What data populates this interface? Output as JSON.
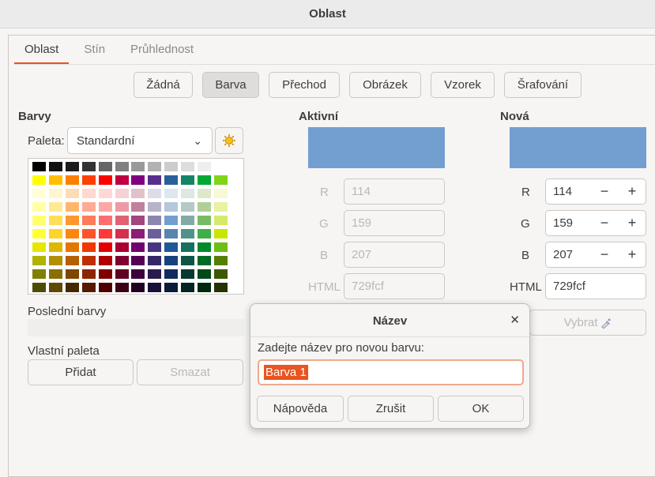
{
  "window": {
    "title": "Oblast"
  },
  "tabs": [
    {
      "label": "Oblast",
      "active": true
    },
    {
      "label": "Stín",
      "active": false
    },
    {
      "label": "Průhlednost",
      "active": false
    }
  ],
  "fill_types": [
    "Žádná",
    "Barva",
    "Přechod",
    "Obrázek",
    "Vzorek",
    "Šrafování"
  ],
  "fill_type_selected": "Barva",
  "colors_panel": {
    "heading": "Barvy",
    "palette_label": "Paleta:",
    "palette_value": "Standardní",
    "recent_label": "Poslední barvy",
    "custom_label": "Vlastní paleta",
    "add_label": "Přidat",
    "delete_label": "Smazat"
  },
  "palette": [
    [
      "#000000",
      "#111111",
      "#1c1c1c",
      "#333333",
      "#666666",
      "#808080",
      "#999999",
      "#b2b2b2",
      "#cccccc",
      "#dddddd",
      "#eeeeee",
      "#ffffff"
    ],
    [
      "#ffff00",
      "#ffbf00",
      "#ff8000",
      "#ff4000",
      "#ff0000",
      "#bf0041",
      "#800080",
      "#55308d",
      "#2a6099",
      "#158466",
      "#00a933",
      "#81d41a"
    ],
    [
      "#ffffd7",
      "#fff5ce",
      "#ffdbb6",
      "#ffd8ce",
      "#ffd7d7",
      "#f7d1d5",
      "#e0c2cd",
      "#dedce6",
      "#dee6ef",
      "#dee7e5",
      "#dde8cb",
      "#f6f9d4"
    ],
    [
      "#ffffa6",
      "#ffe994",
      "#ffb66c",
      "#ffaa95",
      "#ffa6a6",
      "#ec9ba4",
      "#bf819e",
      "#b7b3ca",
      "#b4c7dc",
      "#b3cac7",
      "#afd095",
      "#e8f2a1"
    ],
    [
      "#ffff6d",
      "#ffde59",
      "#ff972f",
      "#ff7b59",
      "#ff6d6d",
      "#e16173",
      "#a1467e",
      "#8e86ae",
      "#729fcf",
      "#81aca6",
      "#77bc65",
      "#d4ea6b"
    ],
    [
      "#ffff38",
      "#ffd428",
      "#ff860d",
      "#ff5429",
      "#ff3838",
      "#d62e4e",
      "#8d1d75",
      "#6b5e9b",
      "#5983b0",
      "#50938a",
      "#3faf46",
      "#c9e600"
    ],
    [
      "#e6e600",
      "#dcb800",
      "#e57500",
      "#f03800",
      "#e50000",
      "#a80035",
      "#700070",
      "#483481",
      "#1f5899",
      "#14715d",
      "#00882c",
      "#6ebe15"
    ],
    [
      "#b2b200",
      "#b18f00",
      "#b45f00",
      "#be2f00",
      "#b20000",
      "#800031",
      "#550055",
      "#382766",
      "#17427e",
      "#0e5447",
      "#006b24",
      "#557f00"
    ],
    [
      "#808000",
      "#8a6e00",
      "#7f4600",
      "#8c2500",
      "#800000",
      "#5f0024",
      "#3d003d",
      "#281c4e",
      "#0f2e5f",
      "#073a30",
      "#004a19",
      "#3c5800"
    ],
    [
      "#4d4d00",
      "#5e4900",
      "#462800",
      "#551a00",
      "#4d0000",
      "#3d0015",
      "#220022",
      "#19113a",
      "#0b1c3a",
      "#04241f",
      "#00280e",
      "#243400"
    ]
  ],
  "active": {
    "heading": "Aktivní",
    "color": "#729fcf",
    "r": "114",
    "g": "159",
    "b": "207",
    "html": "729fcf"
  },
  "new": {
    "heading": "Nová",
    "color": "#729fcf",
    "r": "114",
    "g": "159",
    "b": "207",
    "html": "729fcf",
    "pick_label": "Vybrat"
  },
  "channel_labels": {
    "r": "R",
    "g": "G",
    "b": "B",
    "html": "HTML"
  },
  "stepper": {
    "minus": "−",
    "plus": "+"
  },
  "dialog": {
    "title": "Název",
    "prompt": "Zadejte název pro novou barvu:",
    "value": "Barva 1",
    "help_label": "Nápověda",
    "cancel_label": "Zrušit",
    "ok_label": "OK"
  },
  "icons": {
    "close": "close-icon",
    "dropdown": "chevron-down-icon",
    "palette_options": "sun-gear-icon",
    "eyedropper": "eyedropper-icon"
  }
}
